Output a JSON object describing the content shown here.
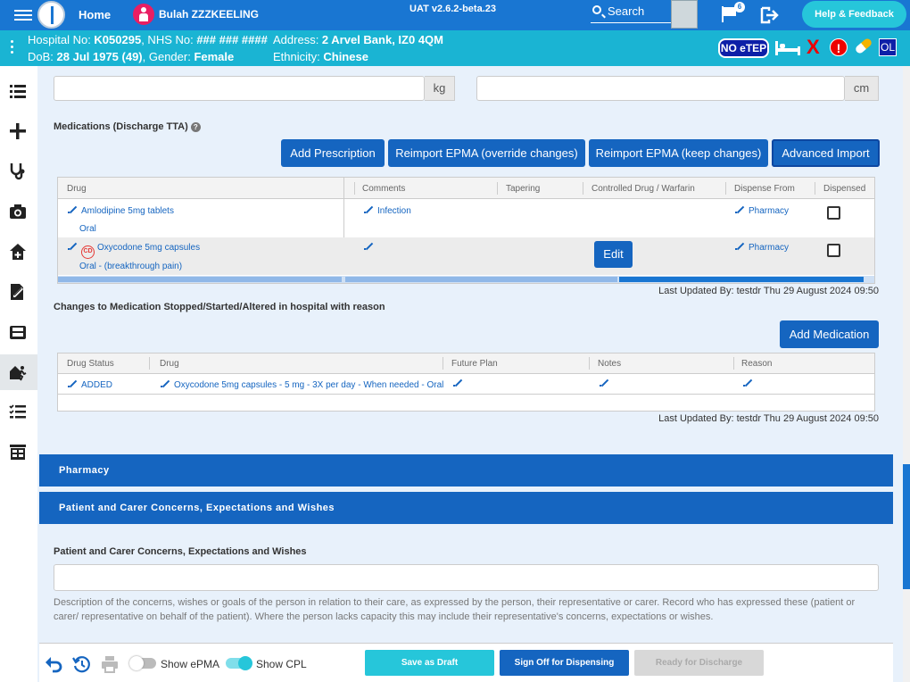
{
  "header": {
    "home_label": "Home",
    "patient_name": "Bulah ZZZKEELING",
    "version": "UAT v2.6.2-beta.23",
    "search_label": "Search",
    "flag_badge": "6",
    "help_label": "Help & Feedback"
  },
  "patient_bar": {
    "hospital_prefix": "Hospital No: ",
    "hospital_no": "K050295",
    "nhs_prefix": ", NHS No: ",
    "nhs_no": "### ### ####",
    "dob_prefix": "DoB: ",
    "dob": "28 Jul 1975 (49)",
    "gender_prefix": ", Gender: ",
    "gender": "Female",
    "address_prefix": "Address: ",
    "address": "2 Arvel Bank, IZ0 4QM",
    "ethnicity_prefix": "Ethnicity: ",
    "ethnicity": "Chinese",
    "netep_label": "NO eTEP",
    "x_label": "X",
    "alert_label": "!",
    "ol_label": "OL"
  },
  "sidenav": {
    "items": [
      "list-icon",
      "plus-icon",
      "stethoscope-icon",
      "camera-icon",
      "home-plus-icon",
      "document-edit-icon",
      "inbox-icon",
      "discharge-icon",
      "checklist-icon",
      "cabinet-icon"
    ],
    "active_index": 7
  },
  "measurements": {
    "weight_unit": "kg",
    "height_unit": "cm"
  },
  "medications": {
    "title": "Medications (Discharge TTA)",
    "help_icon": "?",
    "buttons": {
      "add_prescription": "Add Prescription",
      "reimport_override": "Reimport EPMA (override changes)",
      "reimport_keep": "Reimport EPMA (keep changes)",
      "advanced_import": "Advanced Import"
    },
    "columns": [
      "Drug",
      "Comments",
      "Tapering",
      "Controlled Drug / Warfarin",
      "Dispense From",
      "Dispensed"
    ],
    "rows": [
      {
        "drug": "Amlodipine 5mg tablets",
        "route": "Oral",
        "comment": "Infection",
        "dispense_from": "Pharmacy",
        "controlled": false,
        "cd_badge": "",
        "dispensed": false
      },
      {
        "drug": "Oxycodone 5mg capsules",
        "route": "Oral - (breakthrough pain)",
        "comment": "",
        "dispense_from": "Pharmacy",
        "controlled": true,
        "cd_badge": "CD",
        "dispensed": false
      }
    ],
    "edit_button": "Edit",
    "last_updated": "Last Updated By: testdr Thu 29 August 2024 09:50"
  },
  "changes": {
    "title": "Changes to Medication Stopped/Started/Altered in hospital with reason",
    "add_button": "Add Medication",
    "columns": [
      "Drug Status",
      "Drug",
      "Future Plan",
      "Notes",
      "Reason"
    ],
    "rows": [
      {
        "status": "ADDED",
        "drug": "Oxycodone 5mg capsules - 5 mg - 3X per day - When needed - Oral"
      }
    ],
    "last_updated": "Last Updated By: testdr Thu 29 August 2024 09:50"
  },
  "panels": {
    "pharmacy": "Pharmacy",
    "concerns": "Patient and Carer Concerns, Expectations and Wishes"
  },
  "concerns": {
    "field_label": "Patient and Carer Concerns, Expectations and Wishes",
    "description": "Description of the concerns, wishes or goals of the person in relation to their care, as expressed by the person, their representative or carer. Record who has expressed these (patient or carer/ representative on behalf of the patient). Where the person lacks capacity this may include their representative's concerns, expectations or wishes."
  },
  "footer": {
    "show_epma_label": "Show ePMA",
    "show_epma_on": false,
    "show_cpl_label": "Show CPL",
    "show_cpl_on": true,
    "save_draft": "Save as Draft",
    "sign_off": "Sign Off for Dispensing",
    "ready_discharge": "Ready for Discharge",
    "ready_discharge_enabled": false
  }
}
